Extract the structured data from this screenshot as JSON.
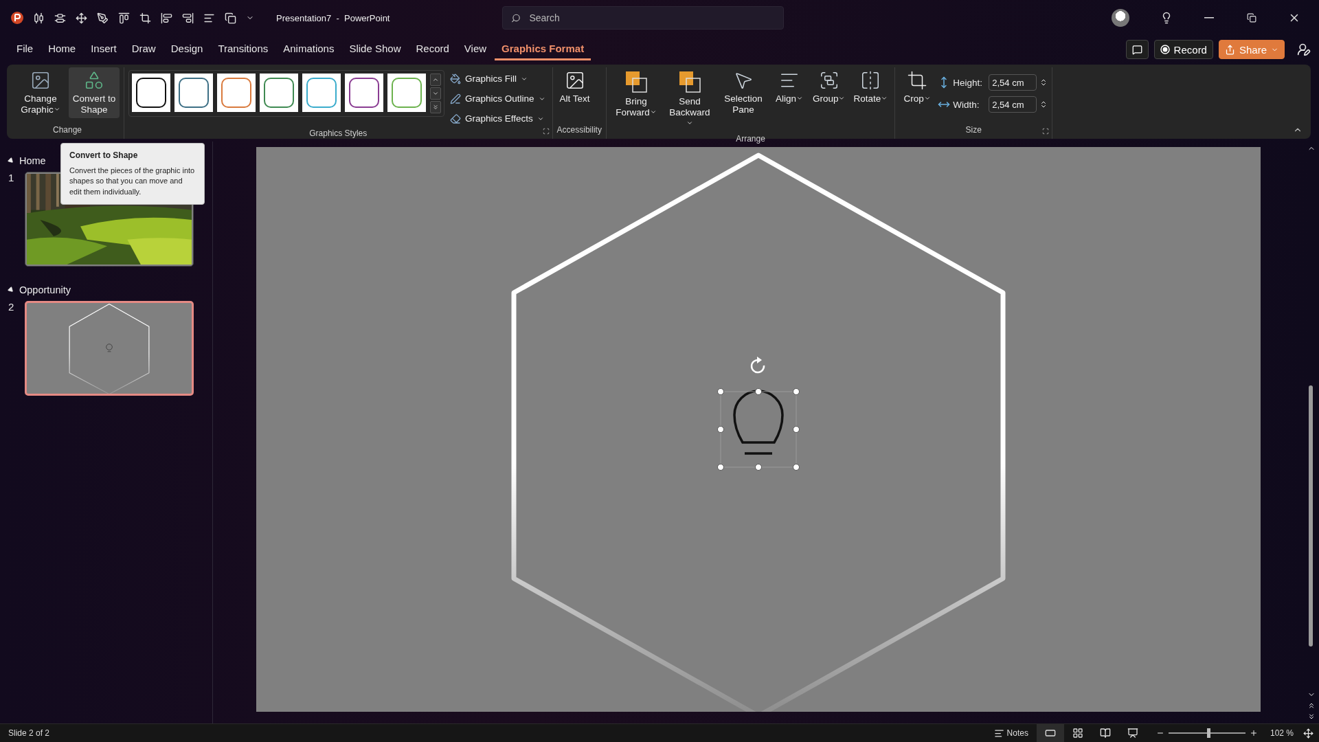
{
  "title_bar": {
    "title": "Presentation7  -  PowerPoint",
    "search": {
      "placeholder": "Search"
    }
  },
  "tabs": [
    {
      "label": "File",
      "selected": false
    },
    {
      "label": "Home",
      "selected": false
    },
    {
      "label": "Insert",
      "selected": false
    },
    {
      "label": "Draw",
      "selected": false
    },
    {
      "label": "Design",
      "selected": false
    },
    {
      "label": "Transitions",
      "selected": false
    },
    {
      "label": "Animations",
      "selected": false
    },
    {
      "label": "Slide Show",
      "selected": false
    },
    {
      "label": "Record",
      "selected": false
    },
    {
      "label": "View",
      "selected": false
    },
    {
      "label": "Graphics Format",
      "selected": true
    }
  ],
  "header_actions": {
    "record": "Record",
    "share": "Share"
  },
  "ribbon": {
    "change": {
      "label": "Change",
      "buttons": [
        {
          "label": "Change Graphic",
          "dropdown": true,
          "hovered": false
        },
        {
          "label": "Convert to Shape",
          "dropdown": false,
          "hovered": true
        }
      ]
    },
    "graphics_styles": {
      "label": "Graphics Styles",
      "styles": [
        {
          "color": "#111111"
        },
        {
          "color": "#3d6f85"
        },
        {
          "color": "#d97a3d"
        },
        {
          "color": "#3f8a52"
        },
        {
          "color": "#3aaccc"
        },
        {
          "color": "#8a3c92"
        },
        {
          "color": "#6cb24e"
        }
      ],
      "commands": [
        "Graphics Fill",
        "Graphics Outline",
        "Graphics Effects"
      ]
    },
    "accessibility": {
      "label": "Accessibility",
      "button": "Alt Text"
    },
    "arrange": {
      "label": "Arrange",
      "buttons": [
        {
          "label": "Bring Forward",
          "dropdown": true
        },
        {
          "label": "Send Backward",
          "dropdown": true
        },
        {
          "label": "Selection Pane",
          "dropdown": false
        },
        {
          "label": "Align",
          "dropdown": true
        },
        {
          "label": "Group",
          "dropdown": true
        },
        {
          "label": "Rotate",
          "dropdown": true
        }
      ]
    },
    "size": {
      "label": "Size",
      "crop": "Crop",
      "height": {
        "label": "Height:",
        "value": "2,54 cm"
      },
      "width": {
        "label": "Width:",
        "value": "2,54 cm"
      }
    }
  },
  "tooltip": {
    "title": "Convert to Shape",
    "body": "Convert the pieces of the graphic into shapes so that you can move and edit them individually."
  },
  "slides_pane": {
    "sections": [
      {
        "title": "Home",
        "expanded": true,
        "slides": [
          {
            "number": "1",
            "selected": false,
            "kind": "picture"
          }
        ]
      },
      {
        "title": "Opportunity",
        "expanded": true,
        "slides": [
          {
            "number": "2",
            "selected": true,
            "kind": "hexagon"
          }
        ]
      }
    ]
  },
  "status_bar": {
    "slide_info": "Slide 2 of 2",
    "notes": "Notes",
    "views": [
      {
        "kind": "normal",
        "selected": true
      },
      {
        "kind": "sorter",
        "selected": false
      },
      {
        "kind": "reading",
        "selected": false
      },
      {
        "kind": "slideshow",
        "selected": false
      }
    ],
    "zoom": {
      "level": 0.52,
      "reading": "102 %"
    }
  }
}
